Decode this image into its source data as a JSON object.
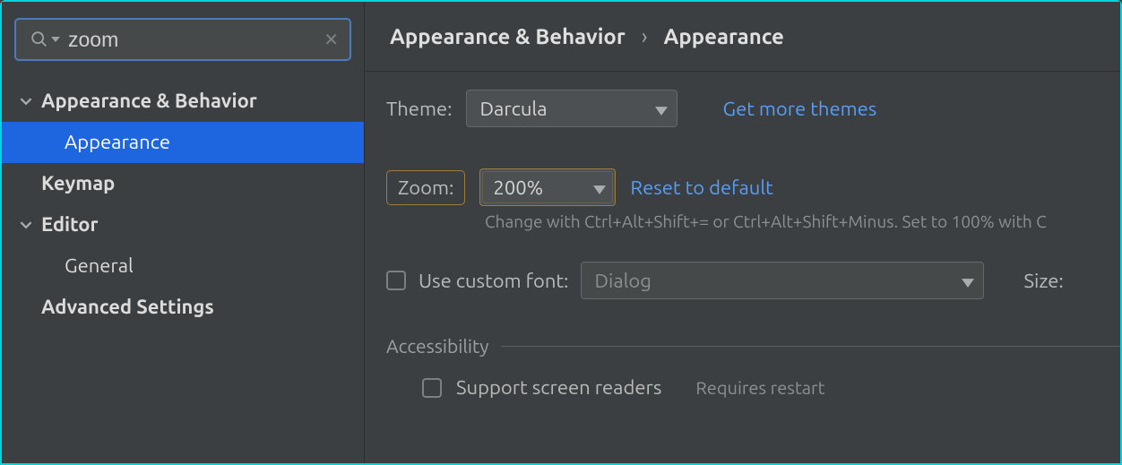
{
  "search": {
    "value": "zoom"
  },
  "sidebar": {
    "items": [
      {
        "label": "Appearance & Behavior"
      },
      {
        "label": "Appearance"
      },
      {
        "label": "Keymap"
      },
      {
        "label": "Editor"
      },
      {
        "label": "General"
      },
      {
        "label": "Advanced Settings"
      }
    ]
  },
  "breadcrumb": {
    "a": "Appearance & Behavior",
    "sep": "›",
    "b": "Appearance"
  },
  "theme": {
    "label": "Theme:",
    "value": "Darcula",
    "link": "Get more themes"
  },
  "zoom": {
    "label": "Zoom:",
    "value": "200%",
    "reset": "Reset to default",
    "hint": "Change with Ctrl+Alt+Shift+= or Ctrl+Alt+Shift+Minus. Set to 100% with C"
  },
  "font": {
    "checkbox_label": "Use custom font:",
    "value": "Dialog",
    "size_label": "Size:"
  },
  "accessibility": {
    "title": "Accessibility",
    "screen_readers": "Support screen readers",
    "restart": "Requires restart"
  }
}
